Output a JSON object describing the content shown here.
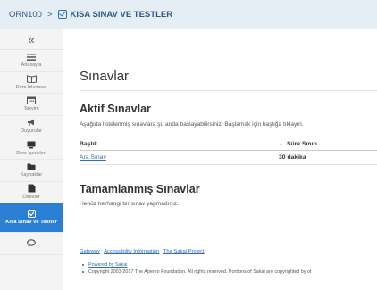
{
  "breadcrumb": {
    "site": "ORN100",
    "separator": ">",
    "tool": "KISA SINAV VE TESTLER"
  },
  "sidebar": {
    "collapse_glyph": "«",
    "items": [
      {
        "label": "Anasayfa",
        "icon": "menu-icon"
      },
      {
        "label": "Ders İzlencesi",
        "icon": "book-icon"
      },
      {
        "label": "Takvim",
        "icon": "calendar-icon"
      },
      {
        "label": "Duyurular",
        "icon": "megaphone-icon"
      },
      {
        "label": "Ders İçerikleri",
        "icon": "content-icon"
      },
      {
        "label": "Kaynaklar",
        "icon": "folder-icon"
      },
      {
        "label": "Ödevler",
        "icon": "assignment-icon"
      },
      {
        "label": "Kısa Sınav ve Testler",
        "icon": "check-icon",
        "active": true
      },
      {
        "label": "",
        "icon": "chat-icon"
      }
    ]
  },
  "main": {
    "title": "Sınavlar",
    "active_heading": "Aktif Sınavlar",
    "active_desc": "Aşağıda listelenmiş sınavlara şu anda başlayabilirsiniz. Başlamak için başlığa tıklayın.",
    "table": {
      "col_title": "Başlık",
      "sort_arrow": "▲",
      "col_time": "Süre Sınırı",
      "rows": [
        {
          "title": "Ara Sınav",
          "time": "30 dakika"
        }
      ]
    },
    "completed_heading": "Tamamlanmış Sınavlar",
    "completed_desc": "Henüz herhangi bir sınav yapmadınız."
  },
  "footer": {
    "links": [
      "Gateway",
      "Accessibility Information",
      "The Sakai Project"
    ],
    "powered": "Powered by Sakai",
    "copyright": "Copyright 2003-2017 The Apereo Foundation. All rights reserved. Portions of Sakai are copyrighted by ot"
  },
  "colors": {
    "accent": "#2b7fd3",
    "link": "#2d6fb0",
    "topbar": "#e6eef5"
  }
}
